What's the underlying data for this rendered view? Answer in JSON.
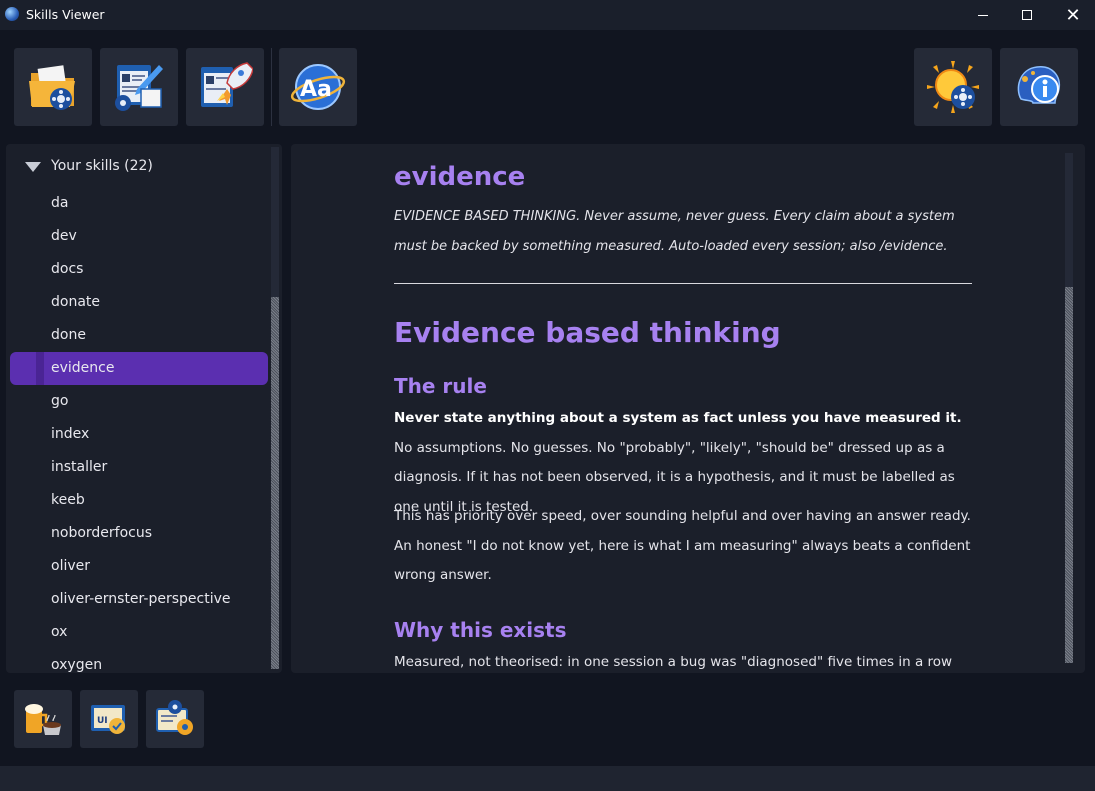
{
  "window": {
    "title": "Skills Viewer",
    "minimize_glyph": "",
    "maximize_glyph": "",
    "close_glyph": "✕"
  },
  "toolbar": {
    "buttons": [
      {
        "icon": "folder-film-icon"
      },
      {
        "icon": "document-edit-icon"
      },
      {
        "icon": "document-rocket-icon"
      },
      {
        "icon": "font-aa-icon"
      },
      {
        "icon": "sun-theme-icon"
      },
      {
        "icon": "info-icon"
      }
    ]
  },
  "sidebar": {
    "tree_label": "Your skills (22)",
    "items": [
      "da",
      "dev",
      "docs",
      "donate",
      "done",
      "evidence",
      "go",
      "index",
      "installer",
      "keeb",
      "noborderfocus",
      "oliver",
      "oliver-ernster-perspective",
      "ox",
      "oxygen"
    ],
    "selected": "evidence"
  },
  "content": {
    "skill_name": "evidence",
    "skill_description": "EVIDENCE BASED THINKING. Never assume, never guess. Every claim about a system must be backed by something measured. Auto-loaded every session; also /evidence.",
    "heading1": "Evidence based thinking",
    "rule_heading": "The rule",
    "rule_bold": "Never state anything about a system as fact unless you have measured it.",
    "rule_text": " No assumptions. No guesses. No \"probably\", \"likely\", \"should be\" dressed up as a diagnosis. If it has not been observed, it is a hypothesis, and it must be labelled as one until it is tested.",
    "priority_text": "This has priority over speed, over sounding helpful and over having an answer ready. An honest \"I do not know yet, here is what I am measuring\" always beats a confident wrong answer.",
    "why_heading": "Why this exists",
    "why_text": "Measured, not theorised: in one session a bug was \"diagnosed\" five times in a row from"
  },
  "bottom_buttons": [
    {
      "icon": "beer-coffee-icon"
    },
    {
      "icon": "certificate-badge-icon"
    },
    {
      "icon": "certificate-gear-icon"
    }
  ],
  "colors": {
    "accent": "#a781f0",
    "selected": "#5b2fb0",
    "background": "#111520",
    "panel": "#1b1f2a"
  }
}
